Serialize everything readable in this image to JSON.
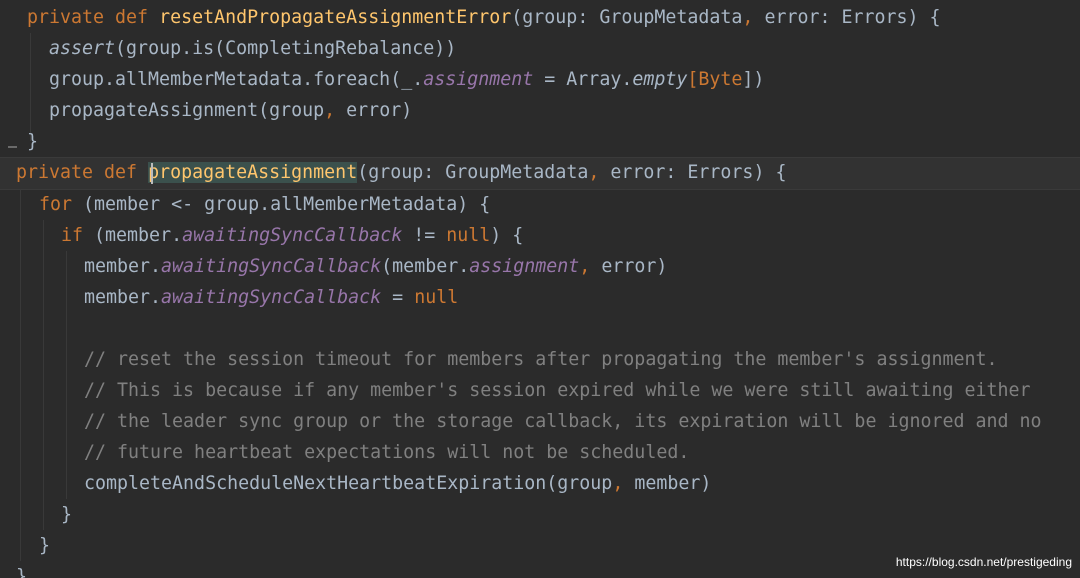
{
  "editor": {
    "watermark": "https://blog.csdn.net/prestigeding",
    "lines": [
      [
        {
          "t": "private def ",
          "c": "keyword"
        },
        {
          "t": "resetAndPropagateAssignmentError",
          "c": "fn"
        },
        {
          "t": "(group: GroupMetadata",
          "c": "plain"
        },
        {
          "t": ", ",
          "c": "punct"
        },
        {
          "t": "error: Errors) {",
          "c": "plain"
        }
      ],
      [
        {
          "t": "assert",
          "c": "italic"
        },
        {
          "t": "(group.is(CompletingRebalance))",
          "c": "plain"
        }
      ],
      [
        {
          "t": "group.allMemberMetadata.foreach(_.",
          "c": "plain"
        },
        {
          "t": "assignment",
          "c": "field"
        },
        {
          "t": " = Array.",
          "c": "plain"
        },
        {
          "t": "empty",
          "c": "italic"
        },
        {
          "t": "[",
          "c": "punct"
        },
        {
          "t": "Byte",
          "c": "keyword"
        },
        {
          "t": "])",
          "c": "plain"
        }
      ],
      [
        {
          "t": "propagateAssignment(group",
          "c": "plain"
        },
        {
          "t": ", ",
          "c": "punct"
        },
        {
          "t": "error)",
          "c": "plain"
        }
      ],
      [
        {
          "t": "}",
          "c": "plain"
        }
      ],
      [
        {
          "t": "private def ",
          "c": "keyword"
        },
        {
          "t": "propagateAssignment",
          "c": "hl"
        },
        {
          "t": "(group: GroupMetadata",
          "c": "plain"
        },
        {
          "t": ", ",
          "c": "punct"
        },
        {
          "t": "error: Errors) {",
          "c": "plain"
        }
      ],
      [
        {
          "t": "for ",
          "c": "keyword"
        },
        {
          "t": "(member <- group.allMemberMetadata) {",
          "c": "plain"
        }
      ],
      [
        {
          "t": "if ",
          "c": "keyword"
        },
        {
          "t": "(member.",
          "c": "plain"
        },
        {
          "t": "awaitingSyncCallback",
          "c": "field"
        },
        {
          "t": " != ",
          "c": "plain"
        },
        {
          "t": "null",
          "c": "keyword"
        },
        {
          "t": ") {",
          "c": "plain"
        }
      ],
      [
        {
          "t": "member.",
          "c": "plain"
        },
        {
          "t": "awaitingSyncCallback",
          "c": "field"
        },
        {
          "t": "(member.",
          "c": "plain"
        },
        {
          "t": "assignment",
          "c": "field"
        },
        {
          "t": ", ",
          "c": "punct"
        },
        {
          "t": "error)",
          "c": "plain"
        }
      ],
      [
        {
          "t": "member.",
          "c": "plain"
        },
        {
          "t": "awaitingSyncCallback",
          "c": "field"
        },
        {
          "t": " = ",
          "c": "plain"
        },
        {
          "t": "null",
          "c": "keyword"
        }
      ],
      [],
      [
        {
          "t": "// reset the session timeout for members after propagating the member's assignment.",
          "c": "comment"
        }
      ],
      [
        {
          "t": "// This is because if any member's session expired while we were still awaiting either",
          "c": "comment"
        }
      ],
      [
        {
          "t": "// the leader sync group or the storage callback, its expiration will be ignored and no",
          "c": "comment"
        }
      ],
      [
        {
          "t": "// future heartbeat expectations will not be scheduled.",
          "c": "comment"
        }
      ],
      [
        {
          "t": "completeAndScheduleNextHeartbeatExpiration(group",
          "c": "plain"
        },
        {
          "t": ", ",
          "c": "punct"
        },
        {
          "t": "member)",
          "c": "plain"
        }
      ],
      [
        {
          "t": "}",
          "c": "plain"
        }
      ],
      [
        {
          "t": "}",
          "c": "plain"
        }
      ],
      [
        {
          "t": "}",
          "c": "plain"
        }
      ]
    ]
  }
}
